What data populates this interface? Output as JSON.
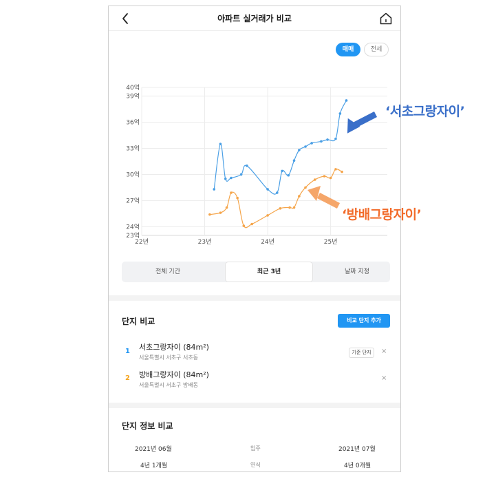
{
  "header": {
    "title": "아파트 실거래가 비교"
  },
  "toggle": {
    "sale": "매매",
    "lease": "전세"
  },
  "chart_data": {
    "type": "line",
    "x_ticks": [
      "22년",
      "23년",
      "24년",
      "25년"
    ],
    "y_ticks": [
      "23억",
      "24억",
      "27억",
      "30억",
      "33억",
      "36억",
      "39억",
      "40억"
    ],
    "ylim": [
      23,
      40
    ],
    "grid": true,
    "series": [
      {
        "name": "서초그랑자이",
        "color": "#4a9fe5",
        "points": [
          [
            2023.15,
            28.3
          ],
          [
            2023.25,
            33.5
          ],
          [
            2023.33,
            29.5
          ],
          [
            2023.42,
            29.6
          ],
          [
            2023.58,
            30.0
          ],
          [
            2023.67,
            31.0
          ],
          [
            2024.0,
            28.3
          ],
          [
            2024.15,
            27.9
          ],
          [
            2024.23,
            30.4
          ],
          [
            2024.33,
            29.9
          ],
          [
            2024.42,
            31.6
          ],
          [
            2024.5,
            32.8
          ],
          [
            2024.6,
            33.2
          ],
          [
            2024.7,
            33.6
          ],
          [
            2024.85,
            33.8
          ],
          [
            2024.95,
            34.0
          ],
          [
            2025.08,
            34.1
          ],
          [
            2025.15,
            37.0
          ],
          [
            2025.25,
            38.5
          ]
        ]
      },
      {
        "name": "방배그랑자이",
        "color": "#f5a54a",
        "points": [
          [
            2023.08,
            25.4
          ],
          [
            2023.25,
            25.6
          ],
          [
            2023.35,
            26.2
          ],
          [
            2023.42,
            27.9
          ],
          [
            2023.52,
            27.3
          ],
          [
            2023.62,
            24.1
          ],
          [
            2023.75,
            24.3
          ],
          [
            2024.0,
            25.3
          ],
          [
            2024.2,
            26.1
          ],
          [
            2024.35,
            26.2
          ],
          [
            2024.42,
            26.2
          ],
          [
            2024.5,
            27.5
          ],
          [
            2024.6,
            28.5
          ],
          [
            2024.75,
            29.4
          ],
          [
            2024.9,
            29.8
          ],
          [
            2025.0,
            29.6
          ],
          [
            2025.08,
            30.6
          ],
          [
            2025.18,
            30.3
          ]
        ]
      }
    ]
  },
  "period_tabs": {
    "all": "전체 기간",
    "recent3": "최근 3년",
    "custom": "날짜 지정"
  },
  "compare": {
    "title": "단지 비교",
    "add_button": "비교 단지 추가",
    "base_badge": "기준 단지",
    "items": [
      {
        "num": "1",
        "name": "서초그랑자이 (84m²)",
        "address": "서울특별시 서초구 서초동",
        "color": "#2196f3"
      },
      {
        "num": "2",
        "name": "방배그랑자이 (84m²)",
        "address": "서울특별시 서초구 방배동",
        "color": "#f5a623"
      }
    ],
    "remove_label": "×"
  },
  "info": {
    "title": "단지 정보 비교",
    "rows": [
      {
        "left": "2021년 06월",
        "label": "입주",
        "right": "2021년 07월"
      },
      {
        "left": "4년 1개월",
        "label": "연식",
        "right": "4년 0개월"
      }
    ]
  },
  "annotations": {
    "label1": "‘서초그랑자이’",
    "label2": "‘방배그랑자이’"
  },
  "colors": {
    "accent": "#2196f3",
    "annotation_blue": "#3a6fc9",
    "annotation_orange": "#f26b2a"
  }
}
